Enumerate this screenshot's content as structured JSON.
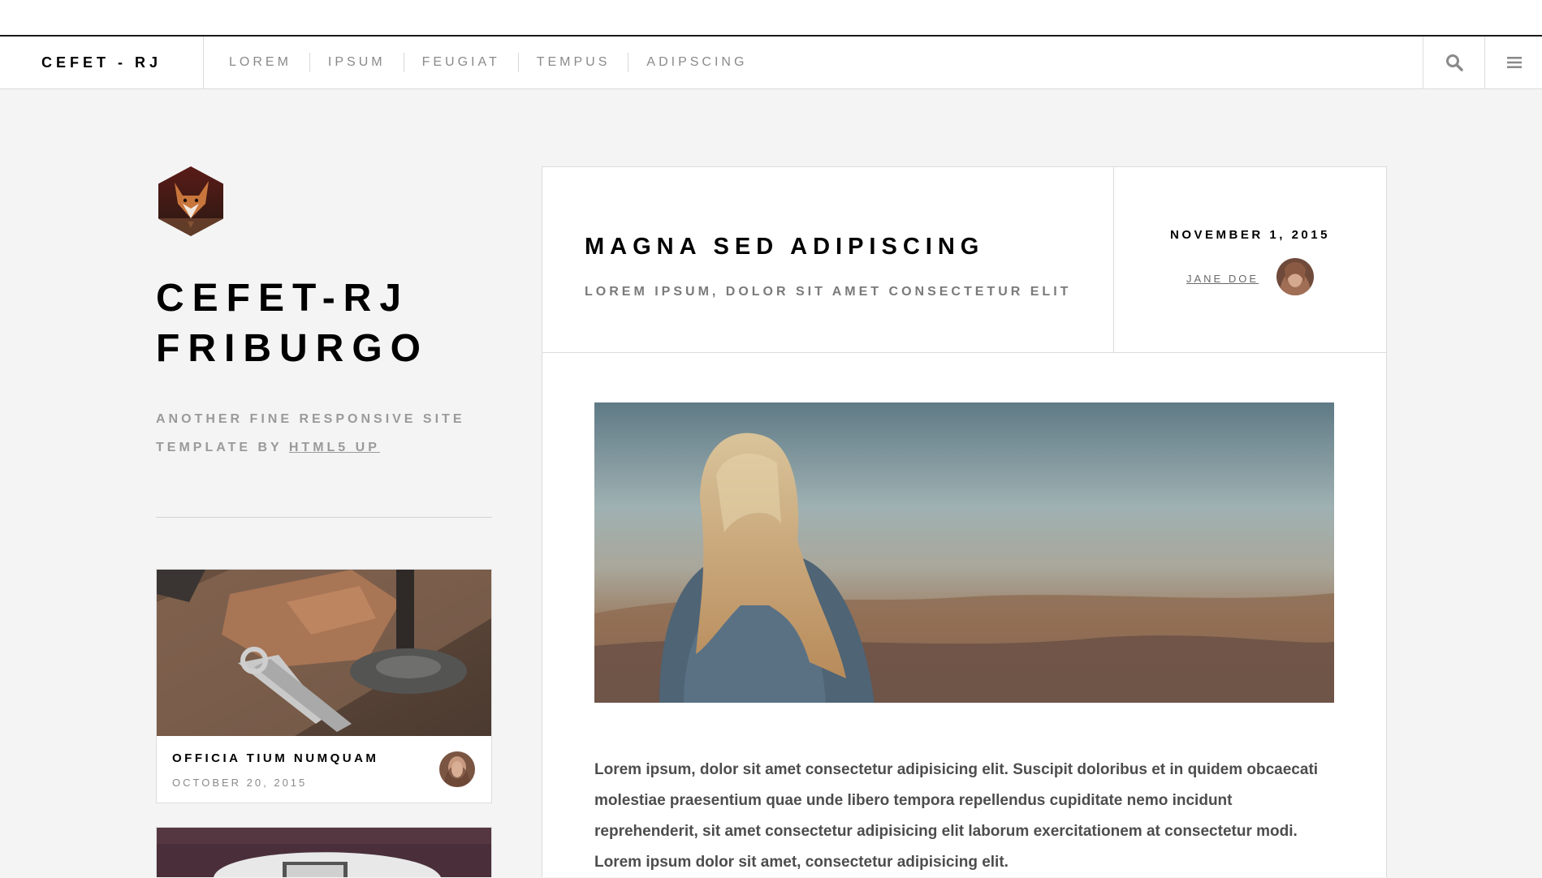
{
  "nav": {
    "brand": "CEFET - RJ",
    "links": [
      "LOREM",
      "IPSUM",
      "FEUGIAT",
      "TEMPUS",
      "ADIPSCING"
    ],
    "search_icon": "search-icon",
    "menu_icon": "hamburger-menu-icon"
  },
  "sidebar": {
    "logo_icon": "fox-hexagon-logo",
    "title_line1": "CEFET-RJ",
    "title_line2": "FRIBURGO",
    "tagline_text": "ANOTHER FINE RESPONSIVE SITE TEMPLATE BY",
    "tagline_link": "HTML5 UP",
    "mini_posts": [
      {
        "title": "OFFICIA TIUM NUMQUAM",
        "date": "OCTOBER 20, 2015"
      }
    ]
  },
  "post": {
    "title": "MAGNA SED ADIPISCING",
    "subtitle": "LOREM IPSUM, DOLOR SIT AMET CONSECTETUR ELIT",
    "date": "NOVEMBER 1, 2015",
    "author": "JANE DOE",
    "body": "Lorem ipsum, dolor sit amet consectetur adipisicing elit. Suscipit doloribus et in quidem obcaecati molestiae praesentium quae unde libero tempora repellendus cupiditate nemo incidunt reprehenderit, sit amet consectetur adipisicing elit laborum exercitationem at consectetur modi. Lorem ipsum dolor sit amet, consectetur adipisicing elit."
  },
  "colors": {
    "background": "#f4f4f4",
    "surface": "#ffffff",
    "border": "#dcdcdc",
    "heading": "#000000",
    "muted": "#9a9a9a"
  }
}
